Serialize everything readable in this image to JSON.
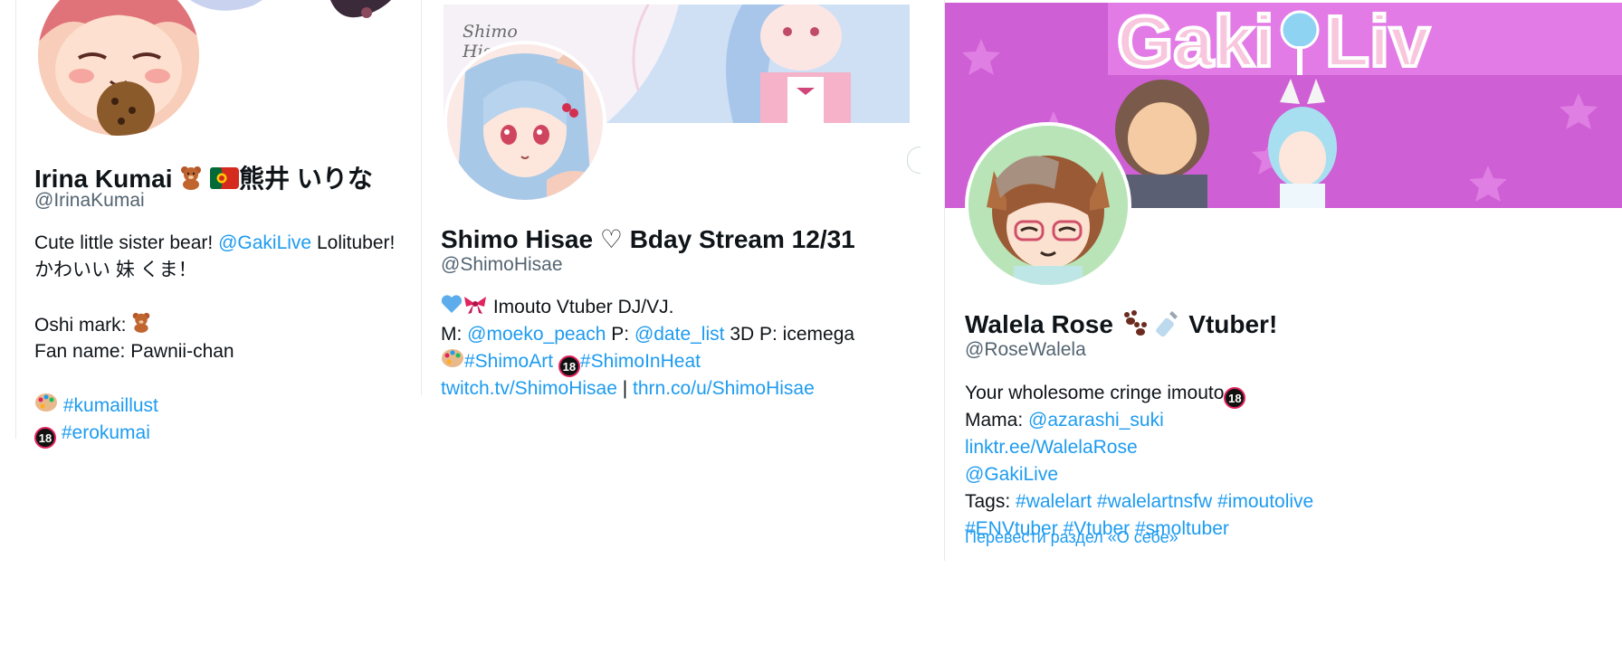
{
  "cards": [
    {
      "name_text": "Irina Kumai",
      "name_jp": "熊井 いりな",
      "handle": "@IrinaKumai",
      "bio": {
        "l1_a": "Cute little sister bear! ",
        "l1_link": "@GakiLive",
        "l1_b": " Lolituber!",
        "l2": "かわいい 妹 くま！",
        "l4": "Oshi mark: ",
        "l5": "Fan name: Pawnii-chan",
        "l7_link": "#kumaillust",
        "l8_link": "#erokumai"
      },
      "icons": [
        "bear-emoji",
        "portugal-flag"
      ]
    },
    {
      "banner_text": "Shimo Hisae",
      "name_text": "Shimo Hisae ♡ Bday Stream 12/31",
      "handle": "@ShimoHisae",
      "bio": {
        "l1": " Imouto Vtuber DJ/VJ.",
        "l2_a": "M: ",
        "l2_link1": "@moeko_peach",
        "l2_b": " P: ",
        "l2_link2": "@date_list",
        "l2_c": " 3D P: icemega",
        "l3_link1": "#ShimoArt",
        "l3_link2": "#ShimoInHeat",
        "l4_link1": "twitch.tv/ShimoHisae",
        "l4_sep": " | ",
        "l4_link2": "thrn.co/u/ShimoHisae"
      }
    },
    {
      "banner_text": "Gaki Live",
      "name_text": "Walela Rose",
      "name_suffix": "Vtuber!",
      "handle": "@RoseWalela",
      "bio": {
        "l1": "Your wholesome cringe imouto",
        "l2_a": "Mama: ",
        "l2_link": "@azarashi_suki",
        "l3_link": "linktr.ee/WalelaRose",
        "l4_link": "@GakiLive",
        "l5_a": "Tags: ",
        "l5_link1": "#walelart",
        "l5_link2": "#walelartnsfw",
        "l5_link3": "#imoutolive",
        "l6_link1": "#ENVtuber",
        "l6_link2": "#Vtuber",
        "l6_link3": "#smoltuber"
      },
      "translate": "Перевести раздел «О себе»"
    }
  ],
  "badge_18": "18",
  "colors": {
    "link": "#1d9bf0",
    "text": "#0f1419",
    "muted": "#536471"
  }
}
